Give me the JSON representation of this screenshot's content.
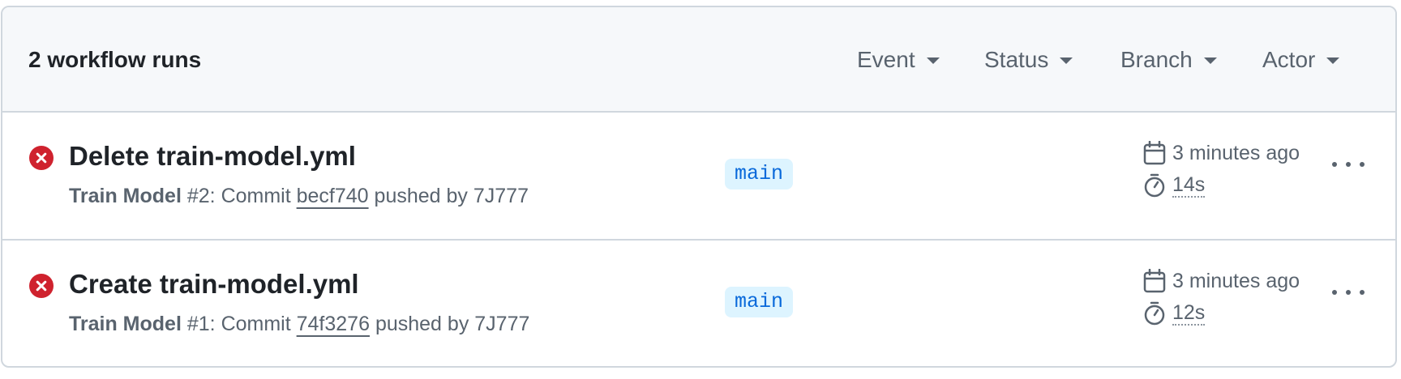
{
  "header": {
    "runs_count": "2 workflow runs",
    "filters": [
      "Event",
      "Status",
      "Branch",
      "Actor"
    ]
  },
  "runs": [
    {
      "status": "failure",
      "title": "Delete train-model.yml",
      "workflow": "Train Model",
      "run_number": "#2",
      "commit_prefix": ": Commit ",
      "sha": "becf740",
      "pushed_by": " pushed by 7J777",
      "branch": "main",
      "time_ago": "3 minutes ago",
      "duration": "14s"
    },
    {
      "status": "failure",
      "title": "Create train-model.yml",
      "workflow": "Train Model",
      "run_number": "#1",
      "commit_prefix": ": Commit ",
      "sha": "74f3276",
      "pushed_by": " pushed by 7J777",
      "branch": "main",
      "time_ago": "3 minutes ago",
      "duration": "12s"
    }
  ],
  "colors": {
    "failure": "#cf222e",
    "branch_bg": "#ddf4ff",
    "branch_fg": "#0969da",
    "muted": "#59636e"
  },
  "icons": {
    "status": "x-circle-fill-icon",
    "date": "calendar-icon",
    "duration": "stopwatch-icon",
    "menu": "kebab-horizontal-icon"
  }
}
